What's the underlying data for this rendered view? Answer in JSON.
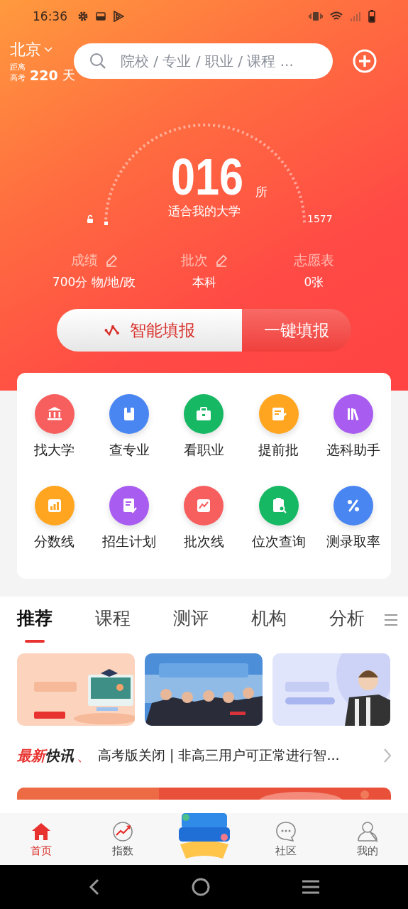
{
  "status_bar": {
    "time": "16:36"
  },
  "location": {
    "city": "北京",
    "countdown_label_1": "距离",
    "countdown_label_2": "高考",
    "days": "220",
    "days_unit": "天"
  },
  "search": {
    "placeholder": "院校 / 专业 / 职业 / 课程 ..."
  },
  "gauge": {
    "value": "016",
    "unit": "所",
    "caption": "适合我的大学",
    "max": "1577"
  },
  "stats": [
    {
      "label": "成绩",
      "value": "700分 物/地/政",
      "editable": true
    },
    {
      "label": "批次",
      "value": "本科",
      "editable": true
    },
    {
      "label": "志愿表",
      "value": "0张",
      "editable": false
    }
  ],
  "fill_buttons": [
    {
      "label": "智能填报",
      "kind": "primary"
    },
    {
      "label": "一键填报",
      "kind": "secondary"
    }
  ],
  "features": [
    {
      "label": "找大学",
      "color": "#f75f5f"
    },
    {
      "label": "查专业",
      "color": "#4a86f2"
    },
    {
      "label": "看职业",
      "color": "#17b864"
    },
    {
      "label": "提前批",
      "color": "#ffa51f"
    },
    {
      "label": "选科助手",
      "color": "#a85cf0"
    },
    {
      "label": "分数线",
      "color": "#ffa51f"
    },
    {
      "label": "招生计划",
      "color": "#a85cf0"
    },
    {
      "label": "批次线",
      "color": "#f75f5f"
    },
    {
      "label": "位次查询",
      "color": "#17b864"
    },
    {
      "label": "测录取率",
      "color": "#4a86f2"
    }
  ],
  "tabs": [
    {
      "label": "推荐",
      "selected": true
    },
    {
      "label": "课程",
      "selected": false
    },
    {
      "label": "测评",
      "selected": false
    },
    {
      "label": "机构",
      "selected": false
    },
    {
      "label": "分析",
      "selected": false
    }
  ],
  "banners": [
    {
      "kind": "picture"
    },
    {
      "kind": "picture"
    },
    {
      "kind": "picture"
    }
  ],
  "news": {
    "tag": "**最新**快讯",
    "separator": "、",
    "headline": "高考版关闭 | 非高三用户可正常进行智..."
  },
  "bottom_nav": [
    {
      "label": "首页",
      "selected": true
    },
    {
      "label": "指数",
      "selected": false
    },
    {
      "kind": "picture"
    },
    {
      "label": "社区",
      "selected": false
    },
    {
      "label": "我的",
      "selected": false
    }
  ]
}
